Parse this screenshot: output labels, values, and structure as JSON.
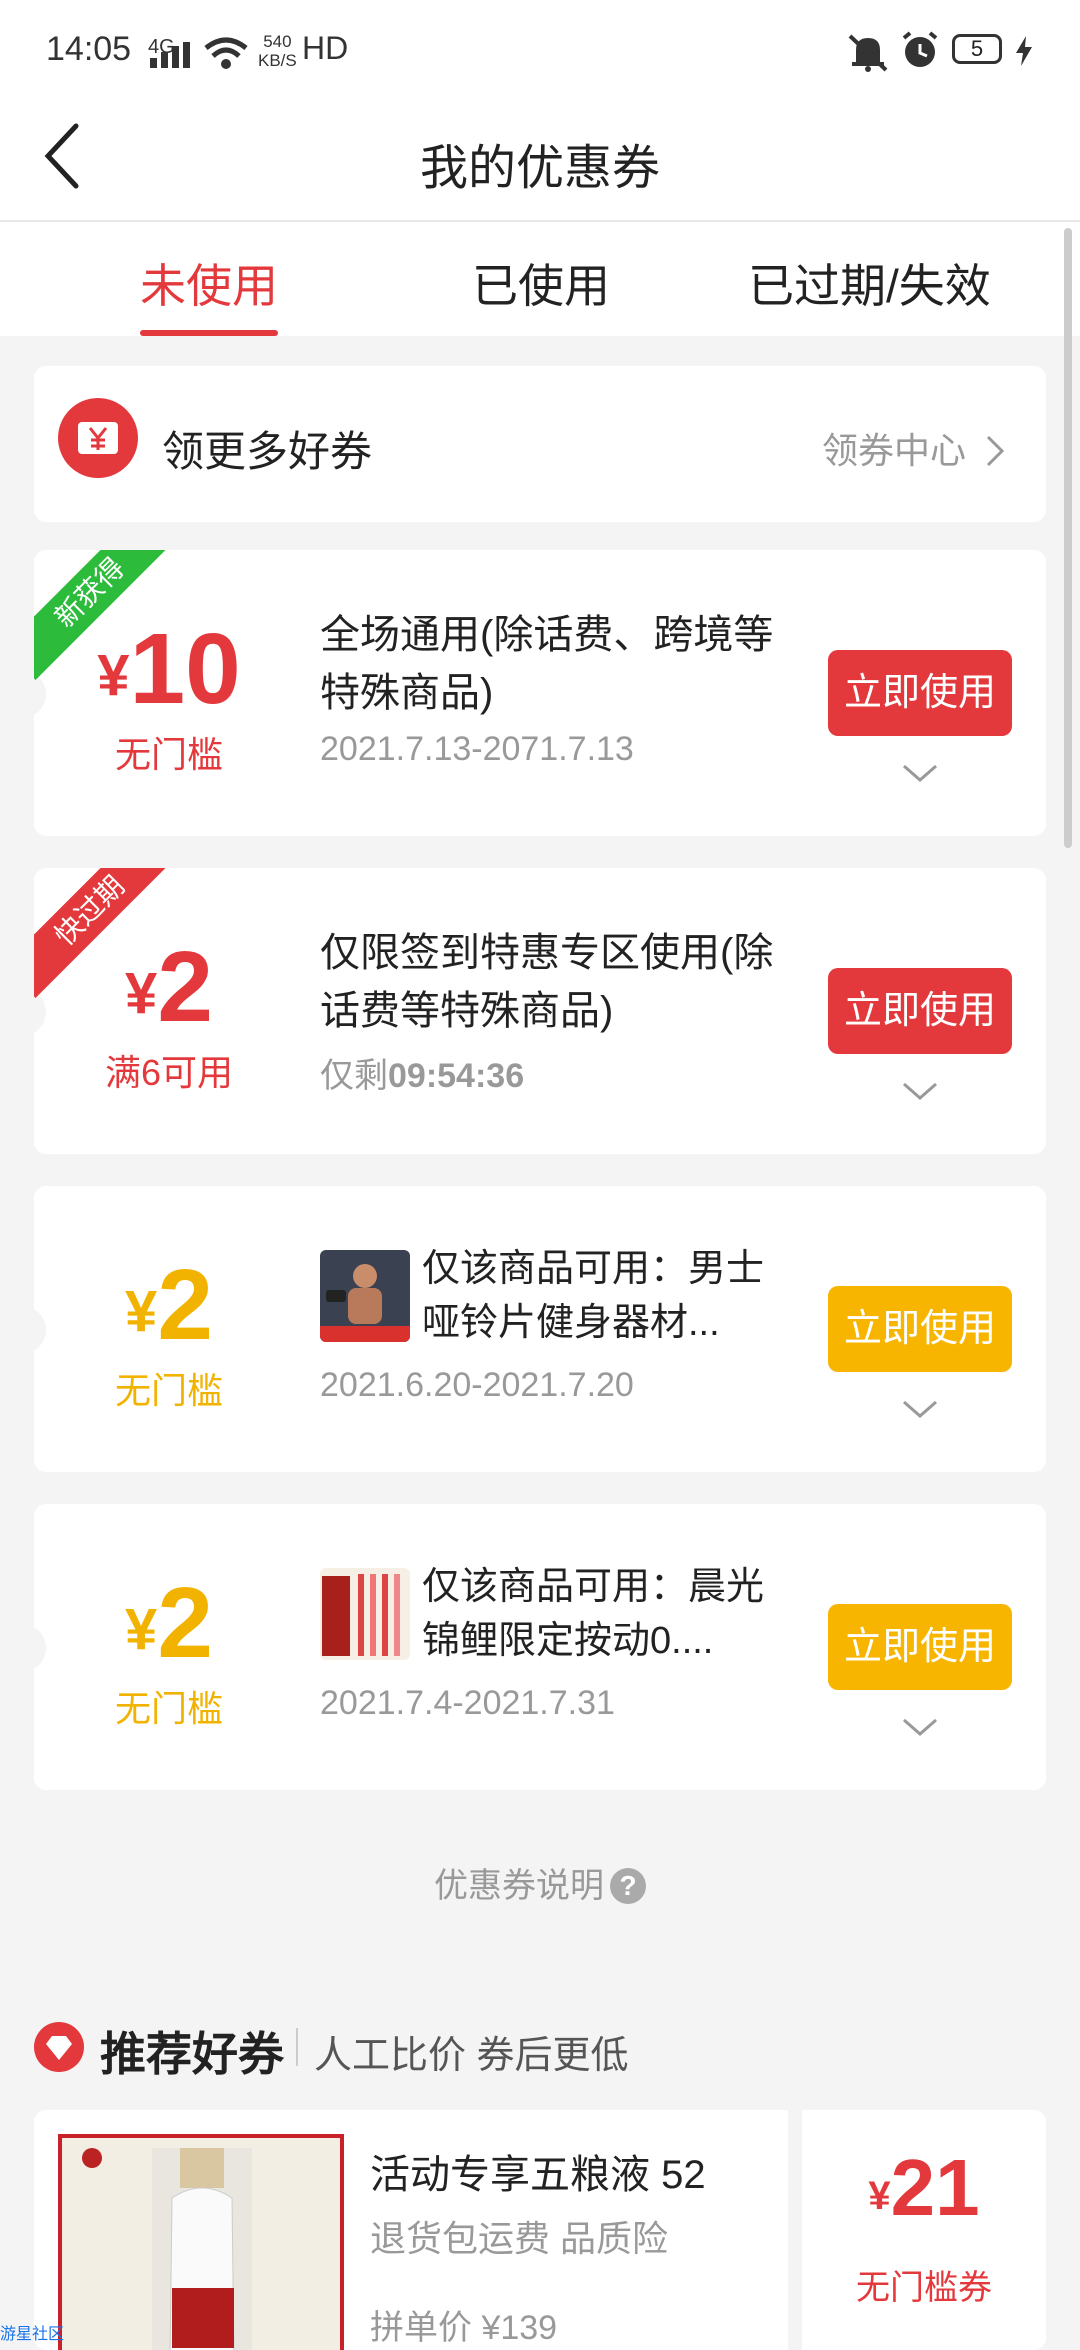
{
  "status_bar": {
    "time": "14:05",
    "network": "4G",
    "speed_value": "540",
    "speed_unit": "KB/S",
    "hd": "HD",
    "battery": "5"
  },
  "nav": {
    "title": "我的优惠券"
  },
  "tabs": [
    {
      "label": "未使用",
      "active": true
    },
    {
      "label": "已使用",
      "active": false
    },
    {
      "label": "已过期/失效",
      "active": false
    }
  ],
  "get_more": {
    "label": "领更多好券",
    "link": "领券中心",
    "icon": "coupon-yuan-icon"
  },
  "coupons": [
    {
      "ribbon": "新获得",
      "currency": "¥",
      "amount": "10",
      "condition": "无门槛",
      "description": "全场通用(除话费、跨境等特殊商品)",
      "date": "2021.7.13-2071.7.13",
      "button": "立即使用",
      "accent": "#e4393c"
    },
    {
      "ribbon": "快过期",
      "currency": "¥",
      "amount": "2",
      "condition": "满6可用",
      "description": "仅限签到特惠专区使用(除话费等特殊商品)",
      "remain_label": "仅剩",
      "remain_time": "09:54:36",
      "button": "立即使用",
      "accent": "#e4393c"
    },
    {
      "currency": "¥",
      "amount": "2",
      "condition": "无门槛",
      "description": "仅该商品可用：男士哑铃片健身器材...",
      "date": "2021.6.20-2021.7.20",
      "button": "立即使用",
      "accent": "#f7b500"
    },
    {
      "currency": "¥",
      "amount": "2",
      "condition": "无门槛",
      "description": "仅该商品可用：晨光锦鲤限定按动0....",
      "date": "2021.7.4-2021.7.31",
      "button": "立即使用",
      "accent": "#f7b500"
    }
  ],
  "explanation": {
    "label": "优惠券说明",
    "help": "?"
  },
  "recommend": {
    "title": "推荐好券",
    "subtitle": "人工比价 券后更低",
    "product": {
      "title": "活动专享五粮液 52",
      "tags": "退货包运费 品质险",
      "price": "拼单价 ¥139",
      "coupon_currency": "¥",
      "coupon_amount": "21",
      "coupon_type": "无门槛券"
    }
  },
  "watermark": "游星社区"
}
